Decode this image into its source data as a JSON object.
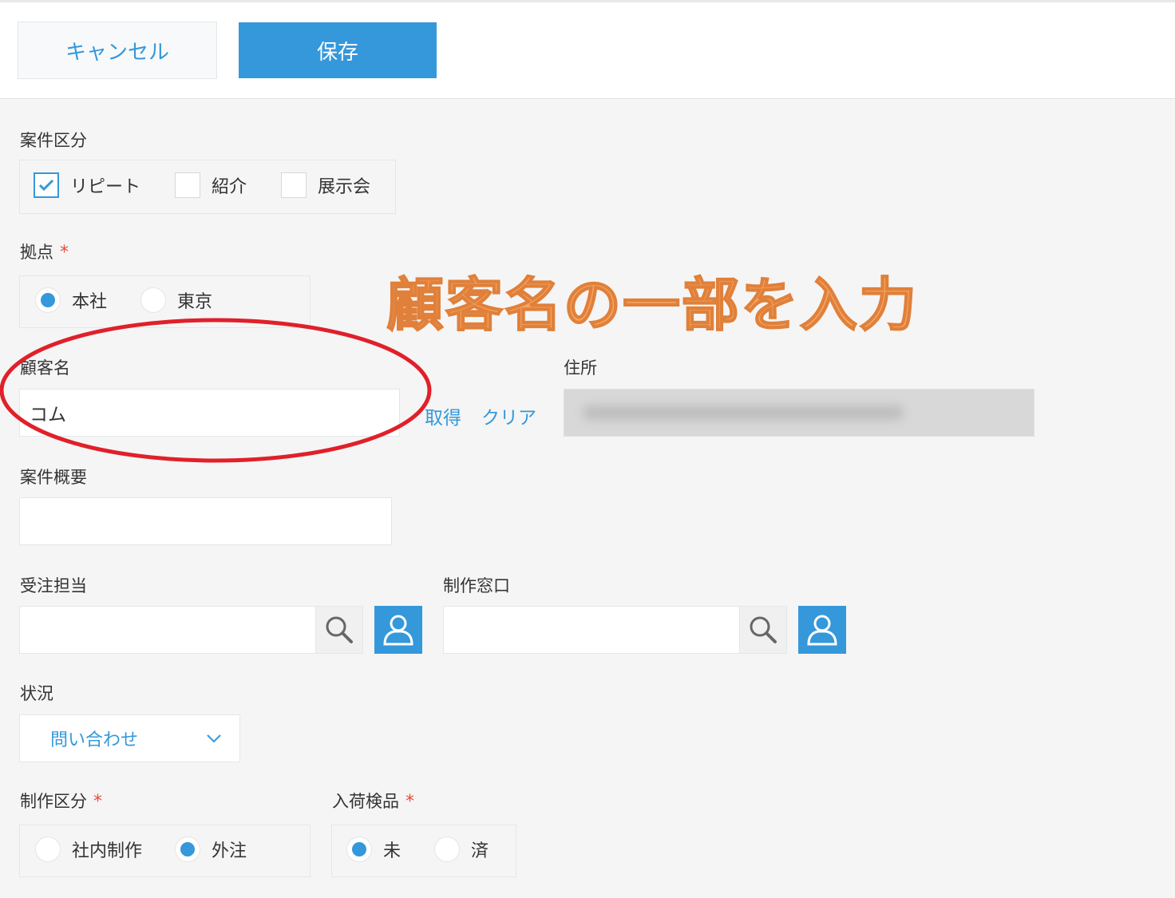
{
  "toolbar": {
    "cancel_label": "キャンセル",
    "save_label": "保存"
  },
  "form": {
    "case_type": {
      "label": "案件区分",
      "options": [
        {
          "label": "リピート",
          "checked": true
        },
        {
          "label": "紹介",
          "checked": false
        },
        {
          "label": "展示会",
          "checked": false
        }
      ]
    },
    "base": {
      "label": "拠点",
      "required_mark": "*",
      "options": [
        {
          "label": "本社",
          "selected": true
        },
        {
          "label": "東京",
          "selected": false
        }
      ]
    },
    "customer": {
      "label": "顧客名",
      "value": "コム",
      "get_link": "取得",
      "clear_link": "クリア"
    },
    "address": {
      "label": "住所"
    },
    "summary": {
      "label": "案件概要",
      "value": ""
    },
    "order_owner": {
      "label": "受注担当",
      "value": ""
    },
    "production_contact": {
      "label": "制作窓口",
      "value": ""
    },
    "status": {
      "label": "状況",
      "selected": "問い合わせ"
    },
    "production_type": {
      "label": "制作区分",
      "required_mark": "*",
      "options": [
        {
          "label": "社内制作",
          "selected": false
        },
        {
          "label": "外注",
          "selected": true
        }
      ]
    },
    "inspection": {
      "label": "入荷検品",
      "required_mark": "*",
      "options": [
        {
          "label": "未",
          "selected": true
        },
        {
          "label": "済",
          "selected": false
        }
      ]
    }
  },
  "annotation": {
    "text": "顧客名の一部を入力",
    "color": "#f4a460",
    "circle_color": "#e0202a"
  },
  "colors": {
    "accent": "#3498db",
    "required": "#e74c3c"
  }
}
